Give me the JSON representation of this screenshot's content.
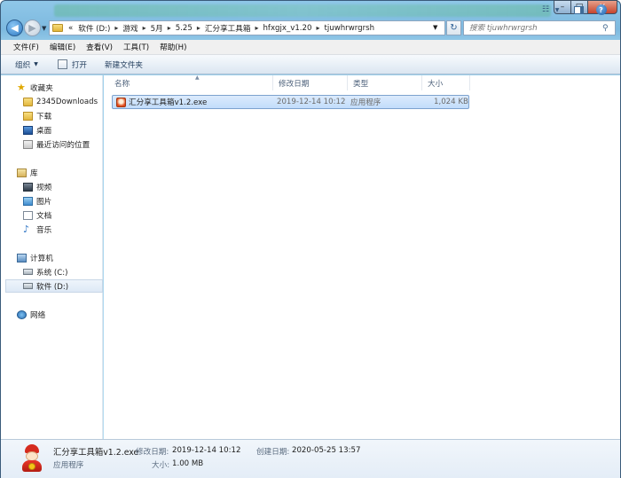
{
  "window": {
    "controls": {
      "minimize": "–",
      "maximize": "□",
      "close": "✕"
    }
  },
  "address": {
    "overflow": "«",
    "segments": [
      "软件 (D:)",
      "游戏",
      "5月",
      "5.25",
      "汇分享工具箱",
      "hfxgjx_v1.20",
      "tjuwhrwrgrsh"
    ]
  },
  "search": {
    "placeholder": "搜索 tjuwhrwrgrsh"
  },
  "menu": [
    "文件(F)",
    "编辑(E)",
    "查看(V)",
    "工具(T)",
    "帮助(H)"
  ],
  "toolbar": {
    "organize": "组织",
    "open": "打开",
    "new_folder": "新建文件夹"
  },
  "nav": {
    "favorites": {
      "label": "收藏夹",
      "items": [
        "2345Downloads",
        "下载",
        "桌面",
        "最近访问的位置"
      ]
    },
    "libraries": {
      "label": "库",
      "items": [
        "视频",
        "图片",
        "文档",
        "音乐"
      ]
    },
    "computer": {
      "label": "计算机",
      "items": [
        "系统 (C:)",
        "软件 (D:)"
      ]
    },
    "network": {
      "label": "网络"
    }
  },
  "columns": {
    "name": "名称",
    "modified": "修改日期",
    "type": "类型",
    "size": "大小"
  },
  "files": [
    {
      "name": "汇分享工具箱v1.2.exe",
      "modified": "2019-12-14 10:12",
      "type": "应用程序",
      "size": "1,024 KB"
    }
  ],
  "details": {
    "filename": "汇分享工具箱v1.2.exe",
    "type": "应用程序",
    "modified_label": "修改日期:",
    "modified_value": "2019-12-14 10:12",
    "created_label": "创建日期:",
    "created_value": "2020-05-25 13:57",
    "size_label": "大小:",
    "size_value": "1.00 MB"
  }
}
